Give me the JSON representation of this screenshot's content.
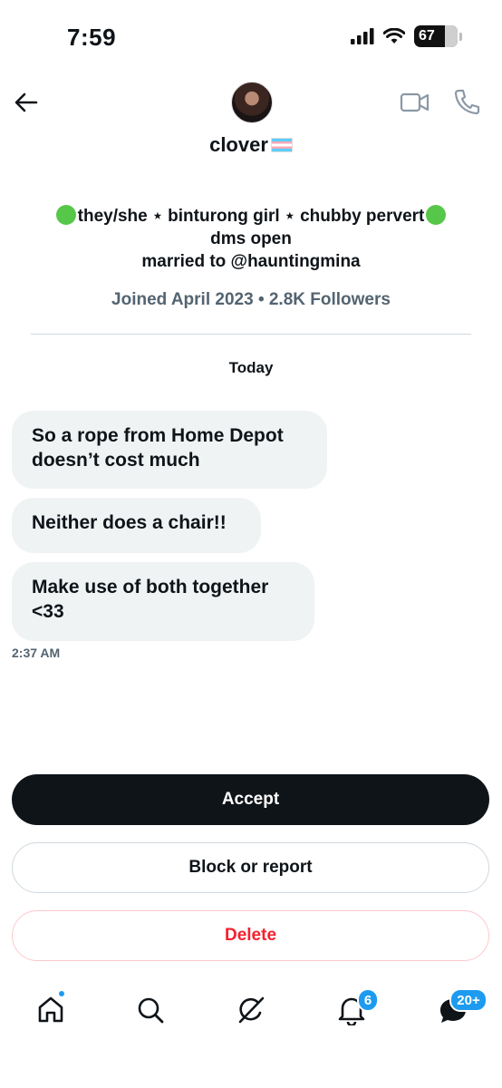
{
  "status_bar": {
    "time": "7:59",
    "battery": "67"
  },
  "header": {
    "name": "clover",
    "icons": [
      "back-arrow-icon",
      "video-call-icon",
      "phone-icon",
      "trans-flag-emoji"
    ]
  },
  "bio": {
    "line1_mid": "they/she ⋆ binturong girl ⋆ chubby pervert",
    "line2": "dms open",
    "line3": "married to @hauntingmina",
    "meta": "Joined April 2023 • 2.8K Followers"
  },
  "conversation": {
    "day_label": "Today",
    "messages": [
      "So a rope from Home Depot doesn’t cost much",
      "Neither does a chair!!",
      "Make use of both together <33"
    ],
    "timestamp": "2:37 AM"
  },
  "actions": {
    "accept": "Accept",
    "block_report": "Block or report",
    "delete": "Delete"
  },
  "tabbar": {
    "notifications_badge": "6",
    "messages_badge": "20+"
  },
  "colors": {
    "accent": "#1d9bf0",
    "danger": "#f4212e",
    "bubble": "#eff3f4",
    "text": "#0f1419",
    "muted": "#536471"
  }
}
